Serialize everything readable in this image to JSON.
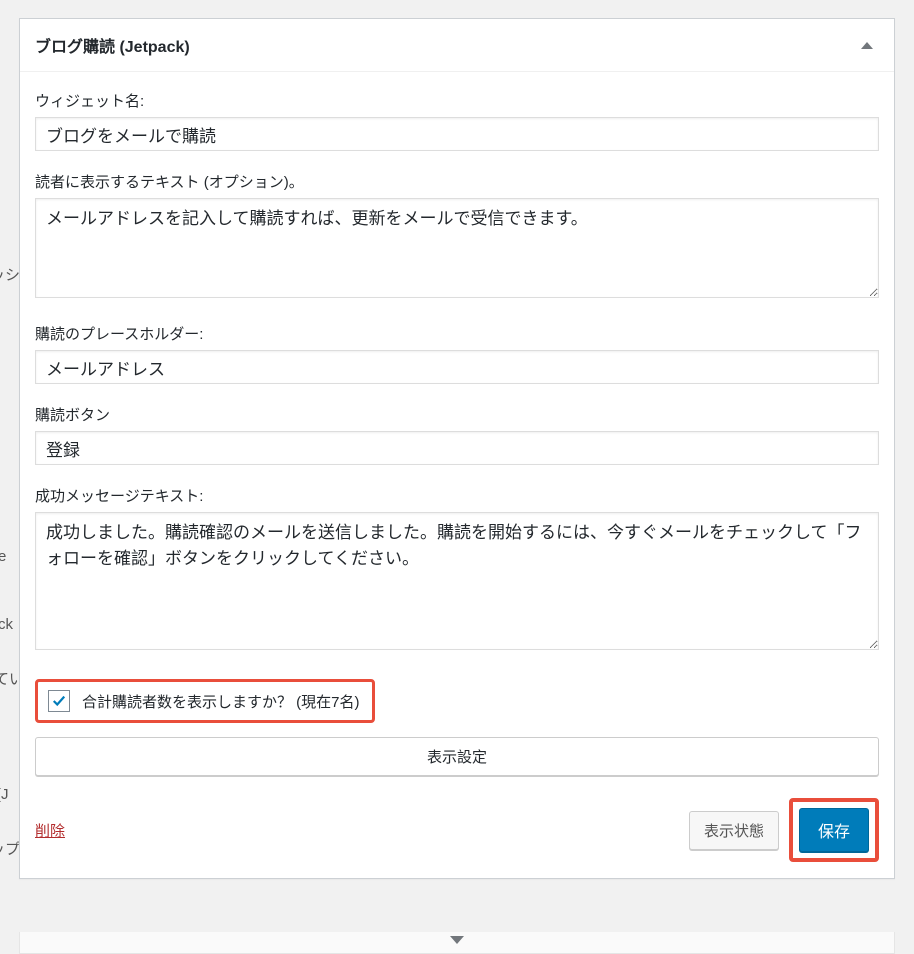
{
  "background": {
    "partial_text_1": "ッシ",
    "partial_text_2": "e",
    "partial_text_3": "ck",
    "partial_text_4": "(J",
    "partial_text_5": "てい",
    "partial_text_6": "ップ"
  },
  "widget": {
    "title": "ブログ購読 (Jetpack)",
    "fields": {
      "widget_name": {
        "label": "ウィジェット名:",
        "value": "ブログをメールで購読"
      },
      "reader_text": {
        "label": "読者に表示するテキスト (オプション)。",
        "value": "メールアドレスを記入して購読すれば、更新をメールで受信できます。"
      },
      "placeholder": {
        "label": "購読のプレースホルダー:",
        "value": "メールアドレス"
      },
      "button": {
        "label": "購読ボタン",
        "value": "登録"
      },
      "success": {
        "label": "成功メッセージテキスト:",
        "value": "成功しました。購読確認のメールを送信しました。購読を開始するには、今すぐメールをチェックして「フォローを確認」ボタンをクリックしてください。"
      }
    },
    "checkbox": {
      "label": "合計購読者数を表示しますか？ (現在7名)",
      "checked": true
    },
    "visibility_button": "表示設定",
    "footer": {
      "delete": "削除",
      "status": "表示状態",
      "save": "保存"
    }
  }
}
